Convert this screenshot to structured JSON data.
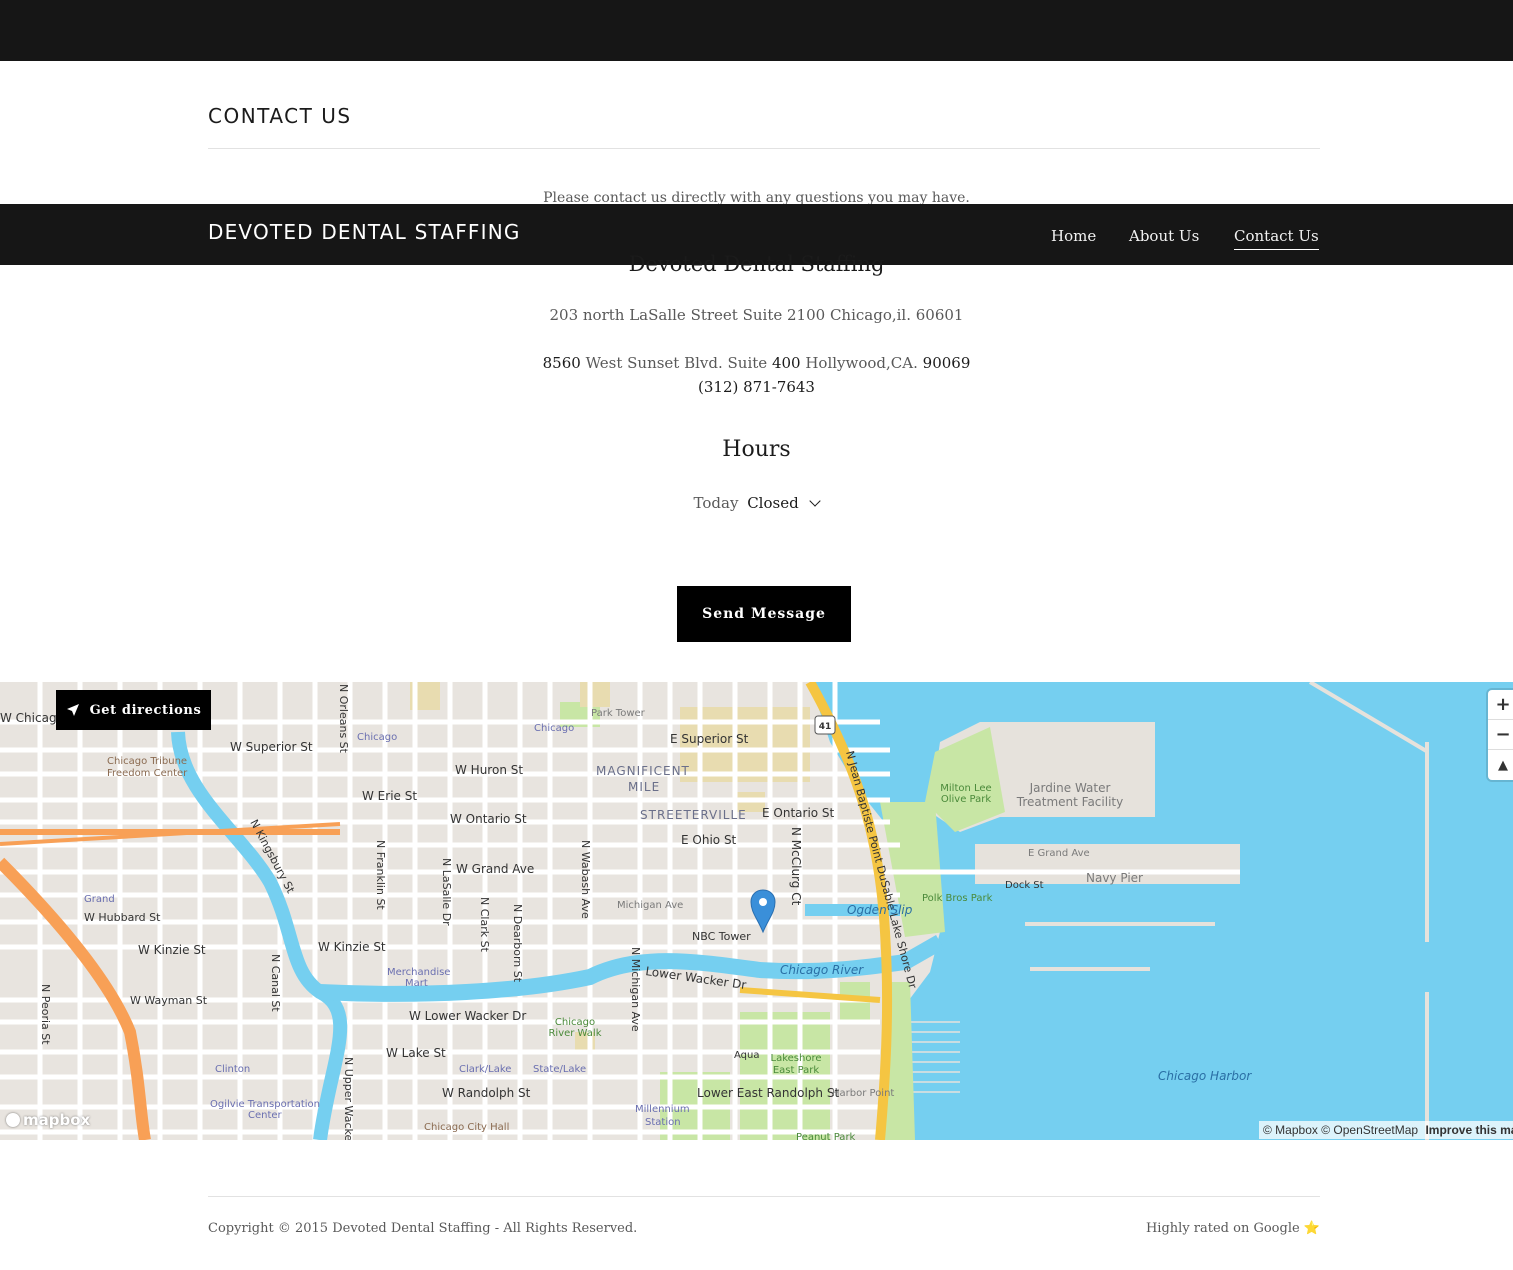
{
  "header": {
    "brand": "DEVOTED DENTAL STAFFING",
    "nav": [
      {
        "label": "Home",
        "active": false
      },
      {
        "label": "About Us",
        "active": false
      },
      {
        "label": "Contact Us",
        "active": true
      }
    ]
  },
  "contact": {
    "section_title": "CONTACT US",
    "intro": "Please contact us directly with any questions you may have.",
    "business_name": "Devoted Dental Staffing",
    "address_1": "203 north LaSalle Street Suite 2100 Chicago,il. 60601",
    "address_2": {
      "number": "8560",
      "street": " West Sunset Blvd. Suite ",
      "suite": "400",
      "city": " Hollywood,CA. ",
      "zip": "90069"
    },
    "phone": "(312) 871-7643",
    "hours_title": "Hours",
    "hours_day": "Today",
    "hours_status": "Closed",
    "send_button": "Send Message"
  },
  "map": {
    "directions_button": "Get directions",
    "zoom_in": "+",
    "zoom_out": "−",
    "reset_north": "▲",
    "logo_text": "mapbox",
    "attribution_mapbox": "© Mapbox",
    "attribution_osm": "© OpenStreetMap",
    "attribution_improve": "Improve this map",
    "water_color": "#75cff0",
    "park_color": "#c8e6a5",
    "road_color": "#ffffff",
    "highway_color": "#f5c542",
    "interstate_color": "#f8a056",
    "marker_color": "#3a8fd9",
    "labels": {
      "superior": "E Superior St",
      "magnificent_1": "MAGNIFICENT",
      "magnificent_2": "MILE",
      "streeterville": "STREETERVILLE",
      "ontario_e": "E Ontario St",
      "ohio": "E Ohio St",
      "mcclurg": "N McClurg Ct",
      "lsd": "N Jean Baptiste Point DuSable Lake Shore Dr",
      "jardine_1": "Jardine Water",
      "jardine_2": "Treatment Facility",
      "milton_1": "Milton Lee",
      "milton_2": "Olive Park",
      "grand_e": "E Grand Ave",
      "navy_pier": "Navy Pier",
      "dock": "Dock St",
      "polk": "Polk Bros Park",
      "ogden": "Ogden Slip",
      "nbc": "NBC Tower",
      "michigan_ave": "Michigan Ave",
      "chicago_river": "Chicago River",
      "lower_wacker": "Lower Wacker Dr",
      "lakeshore_1": "Lakeshore",
      "lakeshore_2": "East Park",
      "aqua": "Aqua",
      "lower_randolph": "Lower East Randolph St",
      "harbor_point": "Harbor Point",
      "peanut": "Peanut Park",
      "chicago_harbor": "Chicago Harbor",
      "millennium_1": "Millennium",
      "millennium_2": "Station",
      "chicago_riverwalk_1": "Chicago",
      "chicago_riverwalk_2": "River Walk",
      "state_lake": "State/Lake",
      "clark_lake": "Clark/Lake",
      "w_lower_wacker": "W Lower Wacker Dr",
      "w_lake": "W Lake St",
      "w_randolph": "W Randolph St",
      "city_hall": "Chicago City Hall",
      "ogilvie_1": "Ogilvie Transportation",
      "ogilvie_2": "Center",
      "clinton": "Clinton",
      "merch_1": "Merchandise",
      "merch_2": "Mart",
      "w_kinzie_1": "W Kinzie St",
      "w_kinzie_2": "W Kinzie St",
      "w_wayman": "W Wayman St",
      "w_hubbard": "W Hubbard St",
      "grand_cta": "Grand",
      "w_grand": "W Grand Ave",
      "w_ontario": "W Ontario St",
      "w_erie": "W Erie St",
      "w_huron": "W Huron St",
      "w_superior": "W Superior St",
      "w_chicago": "W Chicago Ave",
      "chicago_cta_1": "Chicago",
      "chicago_cta_2": "Chicago",
      "park_tower": "Park Tower",
      "tribune_1": "Chicago Tribune",
      "tribune_2": "Freedom Center",
      "kingsbury": "N Kingsbury St",
      "orleans": "N Orleans St",
      "franklin": "N Franklin St",
      "lasalle": "N LaSalle Dr",
      "clark": "N Clark St",
      "dearborn": "N Dearborn St",
      "wabash": "N Wabash Ave",
      "n_michigan": "N Michigan Ave",
      "canal": "N Canal St",
      "peoria": "N Peoria St",
      "upper_wacker": "N Upper Wacker Dr",
      "us41": "41"
    }
  },
  "footer": {
    "copyright": "Copyright © 2015 Devoted Dental Staffing - All Rights Reserved.",
    "rated": "Highly rated on Google",
    "star": "⭐"
  }
}
